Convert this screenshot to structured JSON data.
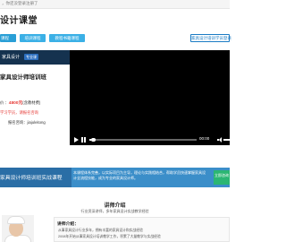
{
  "top_bar": {
    "text": "，你还没登录注册了"
  },
  "site": {
    "title": "设计课堂"
  },
  "nav": {
    "tabs": [
      {
        "label": "课程"
      },
      {
        "label": "培训课程"
      },
      {
        "label": "教程书籍课程"
      }
    ],
    "register_button": "家具设计培训学员登录"
  },
  "course": {
    "banner_label": "家具设计",
    "banner_tag": "专业课",
    "title": "家具设计师培训班",
    "price_label": "价 ：",
    "price": "4800元",
    "price_note": "(含教材费)",
    "red_text": "学习学员，请报名咨询",
    "contact": "报名咨询：jiajuleitong"
  },
  "video": {
    "time_current": "00:00",
    "progress": 0.02,
    "volume": 1.0
  },
  "banner": {
    "title": "家具设计师培训班实战课程",
    "description": "本课程体系完善，以实际项目为主导，理论与实践相结合，帮助学员快速掌握家具设计全流程技能，成为专业的家具设计师。",
    "button_label": "立即咨询"
  },
  "intro": {
    "title": "讲师介绍",
    "subtitle": "行业资深讲师，多年家具设计实战教学经验"
  },
  "teacher": {
    "heading": "讲师介绍：",
    "lines": [
      "从事家具设计行业多年，拥有丰富的家具设计和实战经验",
      "2008年开始从事家具设计培训教学工作，积累了大量教学与实战经验"
    ]
  },
  "colors": {
    "nav_accent": "#2a9fd6",
    "banner": "#3b8ec9",
    "price": "#e53935",
    "consult_button": "#2bb673"
  }
}
